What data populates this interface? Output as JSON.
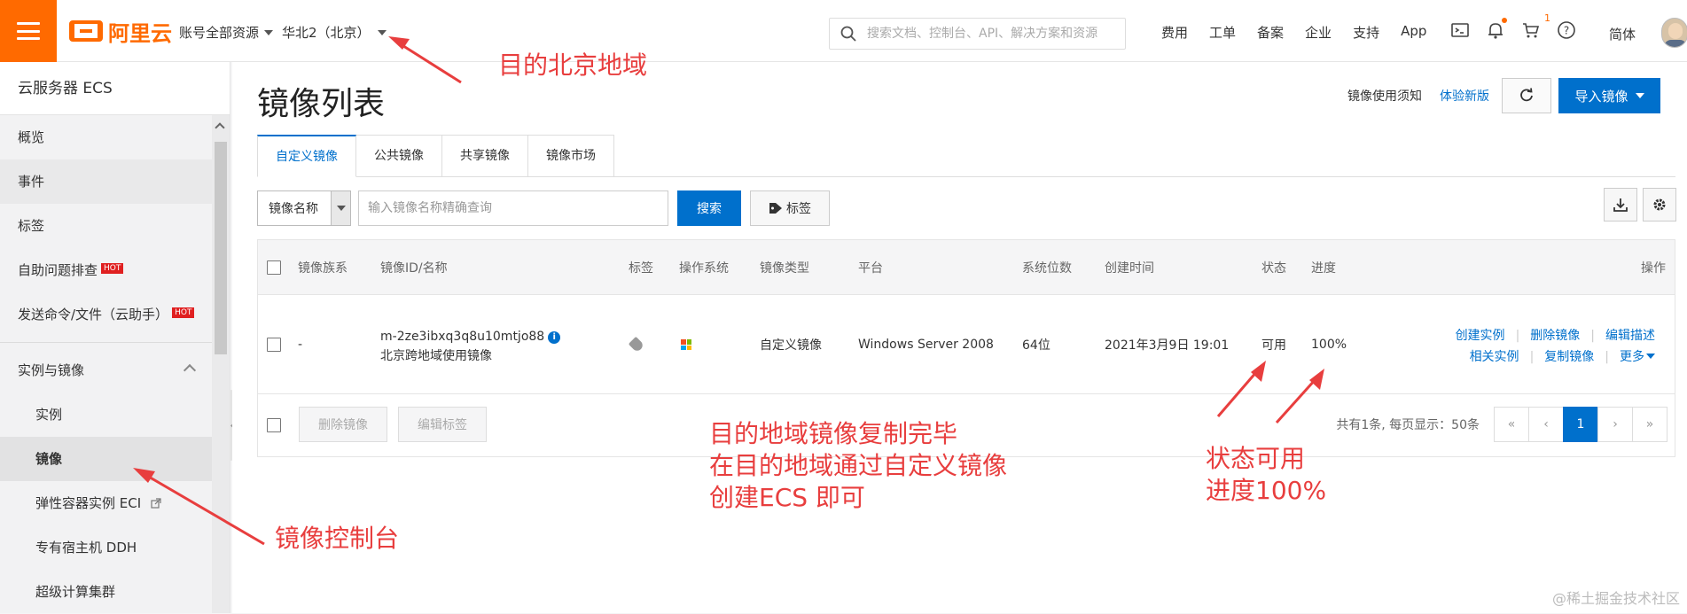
{
  "topbar": {
    "brand": "阿里云",
    "resource_select": "账号全部资源",
    "region": "华北2（北京）",
    "search_placeholder": "搜索文档、控制台、API、解决方案和资源",
    "links": [
      "费用",
      "工单",
      "备案",
      "企业",
      "支持",
      "App"
    ],
    "cart_count": "1",
    "language": "简体"
  },
  "sidebar": {
    "title": "云服务器 ECS",
    "items": [
      {
        "label": "概览"
      },
      {
        "label": "事件"
      },
      {
        "label": "标签"
      },
      {
        "label": "自助问题排查",
        "badge": "HOT"
      },
      {
        "label": "发送命令/文件（云助手）",
        "badge": "HOT"
      }
    ],
    "group": "实例与镜像",
    "sub_items": [
      {
        "label": "实例"
      },
      {
        "label": "镜像"
      },
      {
        "label": "弹性容器实例 ECI"
      },
      {
        "label": "专有宿主机 DDH"
      },
      {
        "label": "超级计算集群"
      }
    ]
  },
  "main": {
    "title": "镜像列表",
    "notice_link": "镜像使用须知",
    "try_new": "体验新版",
    "import_button": "导入镜像",
    "tabs": [
      "自定义镜像",
      "公共镜像",
      "共享镜像",
      "镜像市场"
    ],
    "filter_select": "镜像名称",
    "filter_placeholder": "输入镜像名称精确查询",
    "search_button": "搜索",
    "tag_button": "标签"
  },
  "table": {
    "headers": [
      "镜像族系",
      "镜像ID/名称",
      "标签",
      "操作系统",
      "镜像类型",
      "平台",
      "系统位数",
      "创建时间",
      "状态",
      "进度",
      "操作"
    ],
    "rows": [
      {
        "family": "-",
        "image_id": "m-2ze3ibxq3q8u10mtjo88",
        "image_name": "北京跨地域使用镜像",
        "type": "自定义镜像",
        "platform": "Windows Server 2008",
        "bits": "64位",
        "created": "2021年3月9日 19:01",
        "status": "可用",
        "progress": "100%",
        "actions_line1": [
          "创建实例",
          "删除镜像",
          "编辑描述"
        ],
        "actions_line2": [
          "相关实例",
          "复制镜像",
          "更多"
        ]
      }
    ],
    "footer_buttons": [
      "删除镜像",
      "编辑标签"
    ],
    "total": "共有1条, 每页显示：50条",
    "pager": [
      "«",
      "‹",
      "1",
      "›",
      "»"
    ]
  },
  "annotations": {
    "region_target": "目的北京地域",
    "console": "镜像控制台",
    "copy_done_line1": "目的地域镜像复制完毕",
    "copy_done_line2": "在目的地域通过自定义镜像",
    "copy_done_line3": "创建ECS 即可",
    "status_line1": "状态可用",
    "status_line2": "进度100%"
  },
  "watermark": "@稀土掘金技术社区",
  "colors": {
    "brand": "#ff6a00",
    "primary": "#0070cc",
    "annotation": "#e83e3e"
  }
}
